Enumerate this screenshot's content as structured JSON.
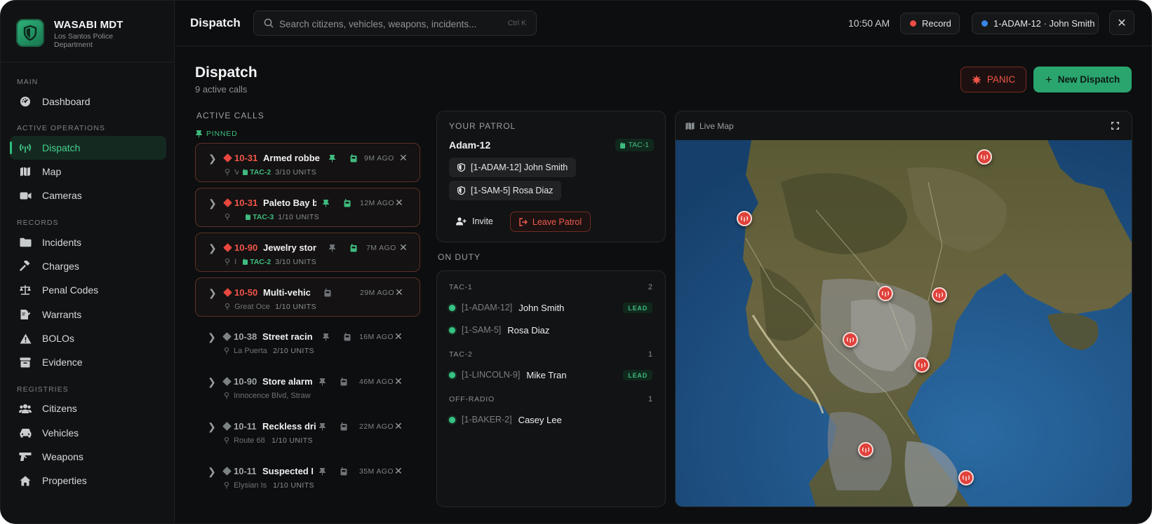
{
  "app": {
    "title": "WASABI MDT",
    "subtitle": "Los Santos Police Department"
  },
  "sidebar": {
    "sections": [
      {
        "label": "MAIN"
      },
      {
        "label": "ACTIVE OPERATIONS"
      },
      {
        "label": "RECORDS"
      },
      {
        "label": "REGISTRIES"
      }
    ],
    "items": [
      {
        "label": "Dashboard",
        "icon": "dashboard-gauge-icon"
      },
      {
        "label": "Dispatch",
        "icon": "radio-tower-icon",
        "active": true
      },
      {
        "label": "Map",
        "icon": "map-icon"
      },
      {
        "label": "Cameras",
        "icon": "video-camera-icon"
      },
      {
        "label": "Incidents",
        "icon": "folder-icon"
      },
      {
        "label": "Charges",
        "icon": "gavel-icon"
      },
      {
        "label": "Penal Codes",
        "icon": "scale-icon"
      },
      {
        "label": "Warrants",
        "icon": "document-pen-icon"
      },
      {
        "label": "BOLOs",
        "icon": "warning-triangle-icon"
      },
      {
        "label": "Evidence",
        "icon": "archive-box-icon"
      },
      {
        "label": "Citizens",
        "icon": "users-icon"
      },
      {
        "label": "Vehicles",
        "icon": "car-icon"
      },
      {
        "label": "Weapons",
        "icon": "gun-icon"
      },
      {
        "label": "Properties",
        "icon": "house-icon"
      }
    ]
  },
  "topbar": {
    "title": "Dispatch",
    "search_placeholder": "Search citizens, vehicles, weapons, incidents...",
    "search_shortcut": "Ctrl K",
    "time": "10:50 AM",
    "record_label": "Record",
    "unit_label": "1-ADAM-12 · John Smith",
    "close_label": "✕"
  },
  "page": {
    "title": "Dispatch",
    "subtitle": "9 active calls",
    "panic_label": "PANIC",
    "new_label": "New Dispatch"
  },
  "calls": {
    "header": "ACTIVE CALLS",
    "pinned_label": "PINNED",
    "items": [
      {
        "code": "10-31",
        "title": "Armed robbe",
        "location": "V",
        "tac": "TAC-2",
        "units": "3/10 UNITS",
        "ago": "9M AGO",
        "pinned": true,
        "priority": "high"
      },
      {
        "code": "10-31",
        "title": "Paleto Bay b",
        "location": "",
        "tac": "TAC-3",
        "units": "1/10 UNITS",
        "ago": "12M AGO",
        "pinned": true,
        "priority": "high"
      },
      {
        "code": "10-90",
        "title": "Jewelry stor",
        "location": "I",
        "tac": "TAC-2",
        "units": "3/10 UNITS",
        "ago": "7M AGO",
        "pinned": true,
        "priority": "high"
      },
      {
        "code": "10-50",
        "title": "Multi-vehic",
        "location": "Great Oce",
        "tac": "",
        "units": "1/10 UNITS",
        "ago": "29M AGO",
        "pinned": true,
        "priority": "high"
      },
      {
        "code": "10-38",
        "title": "Street racin",
        "location": "La Puerta",
        "tac": "",
        "units": "2/10 UNITS",
        "ago": "16M AGO",
        "pinned": false,
        "priority": "normal"
      },
      {
        "code": "10-90",
        "title": "Store alarm",
        "location": "Innocence Blvd, Straw",
        "tac": "",
        "units": "",
        "ago": "46M AGO",
        "pinned": false,
        "priority": "normal"
      },
      {
        "code": "10-11",
        "title": "Reckless dri",
        "location": "Route 68",
        "tac": "",
        "units": "1/10 UNITS",
        "ago": "22M AGO",
        "pinned": false,
        "priority": "normal"
      },
      {
        "code": "10-11",
        "title": "Suspected D",
        "location": "Elysian Is",
        "tac": "",
        "units": "1/10 UNITS",
        "ago": "35M AGO",
        "pinned": false,
        "priority": "normal"
      }
    ]
  },
  "patrol": {
    "header": "YOUR PATROL",
    "name": "Adam-12",
    "tac": "TAC-1",
    "members": [
      "[1-ADAM-12] John Smith",
      "[1-SAM-5] Rosa Diaz"
    ],
    "invite_label": "Invite",
    "leave_label": "Leave Patrol"
  },
  "duty": {
    "header": "ON DUTY",
    "groups": [
      {
        "name": "TAC-1",
        "count": "2",
        "officers": [
          {
            "callsign": "[1-ADAM-12]",
            "name": "John Smith",
            "lead": "LEAD"
          },
          {
            "callsign": "[1-SAM-5]",
            "name": "Rosa Diaz",
            "lead": ""
          }
        ]
      },
      {
        "name": "TAC-2",
        "count": "1",
        "officers": [
          {
            "callsign": "[1-LINCOLN-9]",
            "name": "Mike Tran",
            "lead": "LEAD"
          }
        ]
      },
      {
        "name": "OFF-RADIO",
        "count": "1",
        "officers": [
          {
            "callsign": "[1-BAKER-2]",
            "name": "Casey Lee",
            "lead": ""
          }
        ]
      }
    ]
  },
  "map": {
    "label": "Live Map",
    "marker_icon": "radio-tower-icon",
    "marker_count": 9
  },
  "colors": {
    "accent": "#2aa56e",
    "danger": "#e0413a",
    "bg": "#0d0e0f"
  }
}
